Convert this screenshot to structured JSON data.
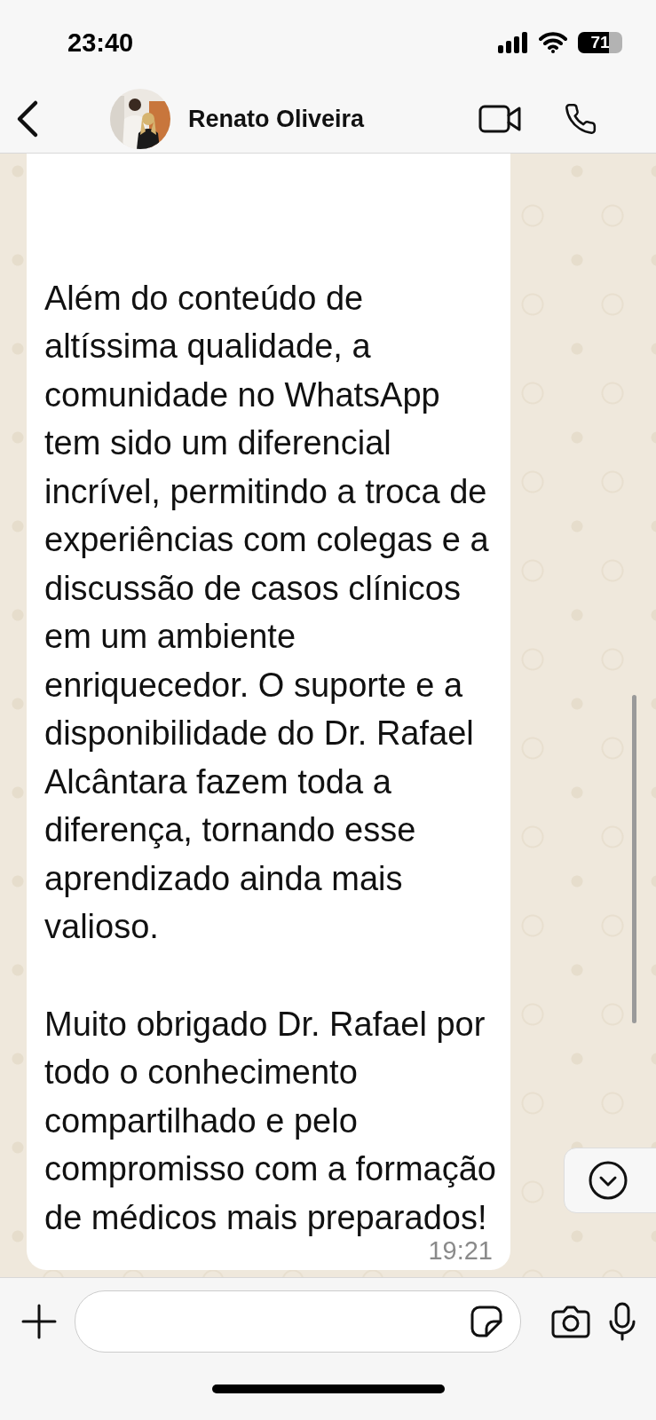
{
  "status_bar": {
    "time": "23:40",
    "battery": "71"
  },
  "header": {
    "contact_name": "Renato Oliveira"
  },
  "messages": [
    {
      "paragraphs": [
        "Além do conteúdo de altíssima qualidade, a comunidade no WhatsApp tem sido um diferencial incrível, permitindo a troca de experiências com colegas e a discussão de casos clínicos em um ambiente enriquecedor. O suporte e a disponibilidade do Dr. Rafael Alcântara fazem toda a diferença, tornando esse aprendizado ainda mais valioso.",
        "Muito obrigado Dr. Rafael por todo o conhecimento compartilhado e pelo compromisso com a formação de médicos mais preparados!"
      ],
      "time": "19:21"
    }
  ]
}
